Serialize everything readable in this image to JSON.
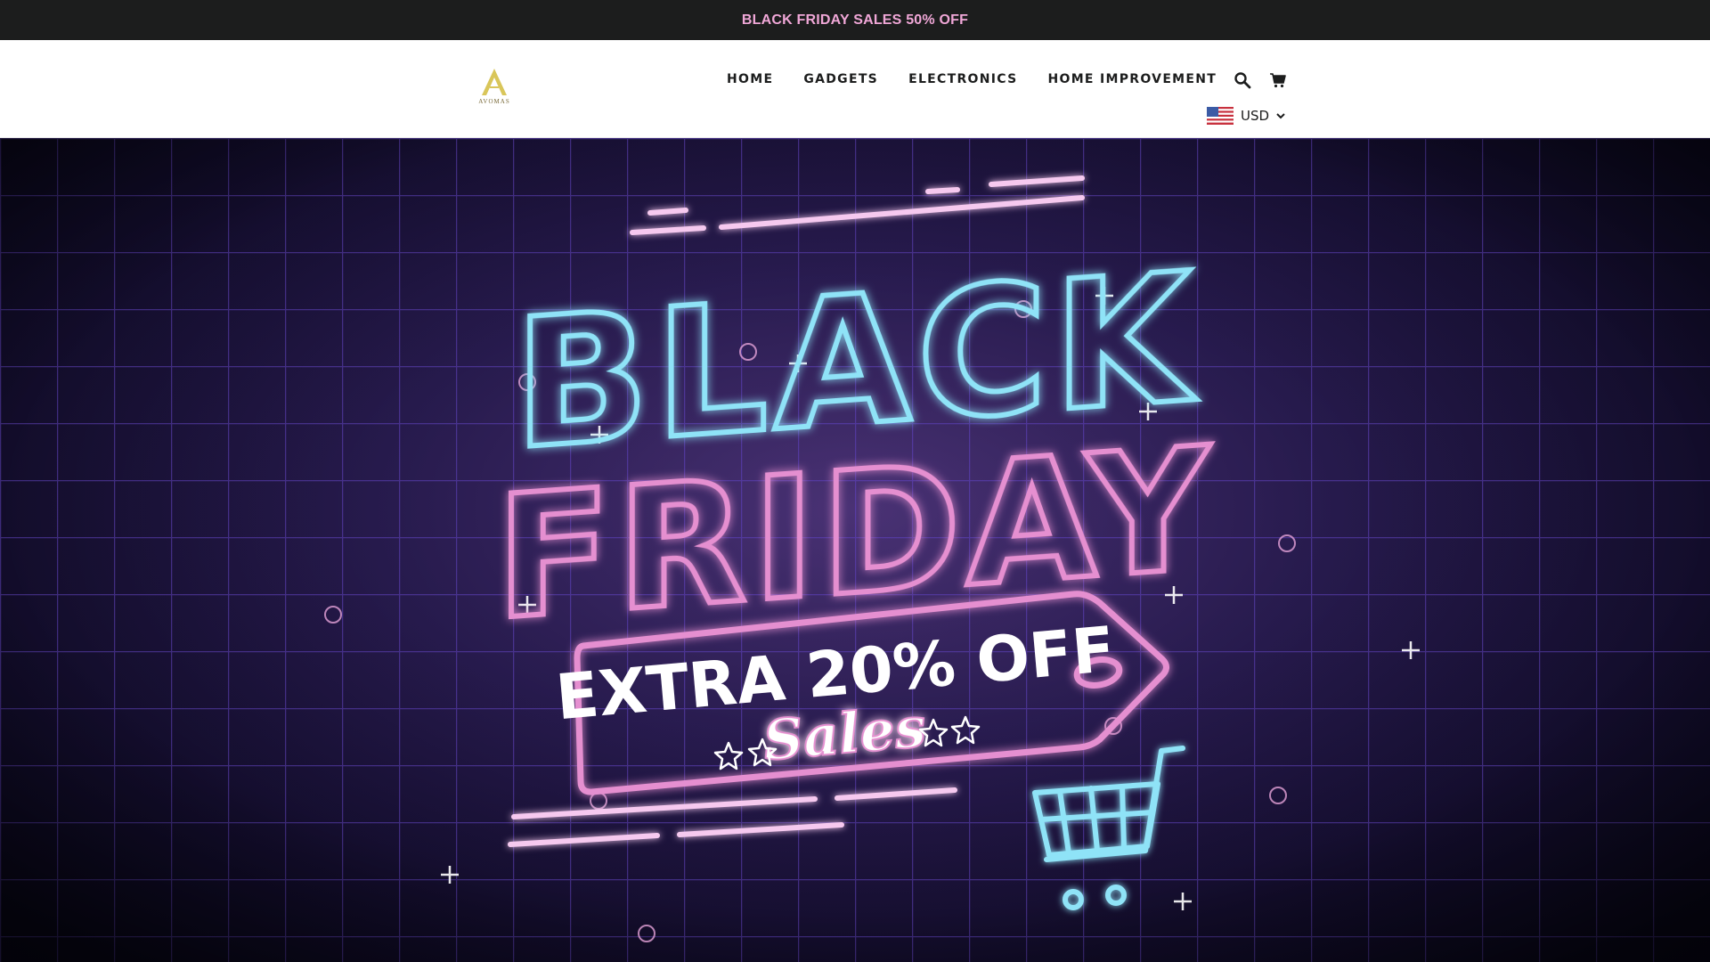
{
  "announcement": {
    "text": "BLACK FRIDAY SALES 50% OFF"
  },
  "logo": {
    "text": "AVOMAS"
  },
  "nav": {
    "items": [
      {
        "label": "HOME"
      },
      {
        "label": "GADGETS"
      },
      {
        "label": "ELECTRONICS"
      },
      {
        "label": "HOME IMPROVEMENT"
      }
    ]
  },
  "icons": {
    "search": "search-icon",
    "cart": "cart-icon",
    "flag": "us-flag-icon",
    "chevron": "chevron-down-icon"
  },
  "currency": {
    "selected": "USD"
  },
  "hero": {
    "line1": "BLACK",
    "line2": "FRIDAY",
    "tag_text": "EXTRA 20% OFF",
    "tag_subtext": "Sales"
  },
  "colors": {
    "announcement_bg": "#1c1d1d",
    "announcement_text": "#f0a7d7",
    "neon_blue": "#8fe3f7",
    "neon_pink": "#e58fd0",
    "hero_bg": "#2b1d55"
  }
}
